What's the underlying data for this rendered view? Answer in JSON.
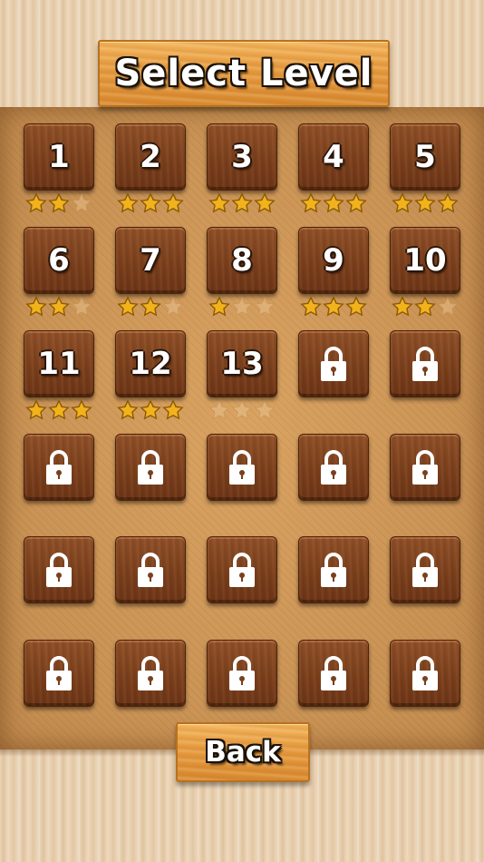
{
  "header": {
    "title": "Select Level"
  },
  "footer": {
    "back_label": "Back"
  },
  "levels": [
    {
      "label": "1",
      "locked": false,
      "stars": 2
    },
    {
      "label": "2",
      "locked": false,
      "stars": 3
    },
    {
      "label": "3",
      "locked": false,
      "stars": 3
    },
    {
      "label": "4",
      "locked": false,
      "stars": 3
    },
    {
      "label": "5",
      "locked": false,
      "stars": 3
    },
    {
      "label": "6",
      "locked": false,
      "stars": 2
    },
    {
      "label": "7",
      "locked": false,
      "stars": 2
    },
    {
      "label": "8",
      "locked": false,
      "stars": 1
    },
    {
      "label": "9",
      "locked": false,
      "stars": 3
    },
    {
      "label": "10",
      "locked": false,
      "stars": 2
    },
    {
      "label": "11",
      "locked": false,
      "stars": 3
    },
    {
      "label": "12",
      "locked": false,
      "stars": 3
    },
    {
      "label": "13",
      "locked": false,
      "stars": 0
    },
    {
      "label": "",
      "locked": true,
      "stars": null
    },
    {
      "label": "",
      "locked": true,
      "stars": null
    },
    {
      "label": "",
      "locked": true,
      "stars": null
    },
    {
      "label": "",
      "locked": true,
      "stars": null
    },
    {
      "label": "",
      "locked": true,
      "stars": null
    },
    {
      "label": "",
      "locked": true,
      "stars": null
    },
    {
      "label": "",
      "locked": true,
      "stars": null
    },
    {
      "label": "",
      "locked": true,
      "stars": null
    },
    {
      "label": "",
      "locked": true,
      "stars": null
    },
    {
      "label": "",
      "locked": true,
      "stars": null
    },
    {
      "label": "",
      "locked": true,
      "stars": null
    },
    {
      "label": "",
      "locked": true,
      "stars": null
    },
    {
      "label": "",
      "locked": true,
      "stars": null
    },
    {
      "label": "",
      "locked": true,
      "stars": null
    },
    {
      "label": "",
      "locked": true,
      "stars": null
    },
    {
      "label": "",
      "locked": true,
      "stars": null
    },
    {
      "label": "",
      "locked": true,
      "stars": null
    }
  ],
  "icons": {
    "locked_tile": "padlock-icon",
    "star_filled": "star-icon",
    "star_empty": "star-empty-icon"
  },
  "colors": {
    "star_gold": "#f2b21c",
    "tile_wood": "#7a3f1c",
    "plank": "#e69a3e"
  }
}
